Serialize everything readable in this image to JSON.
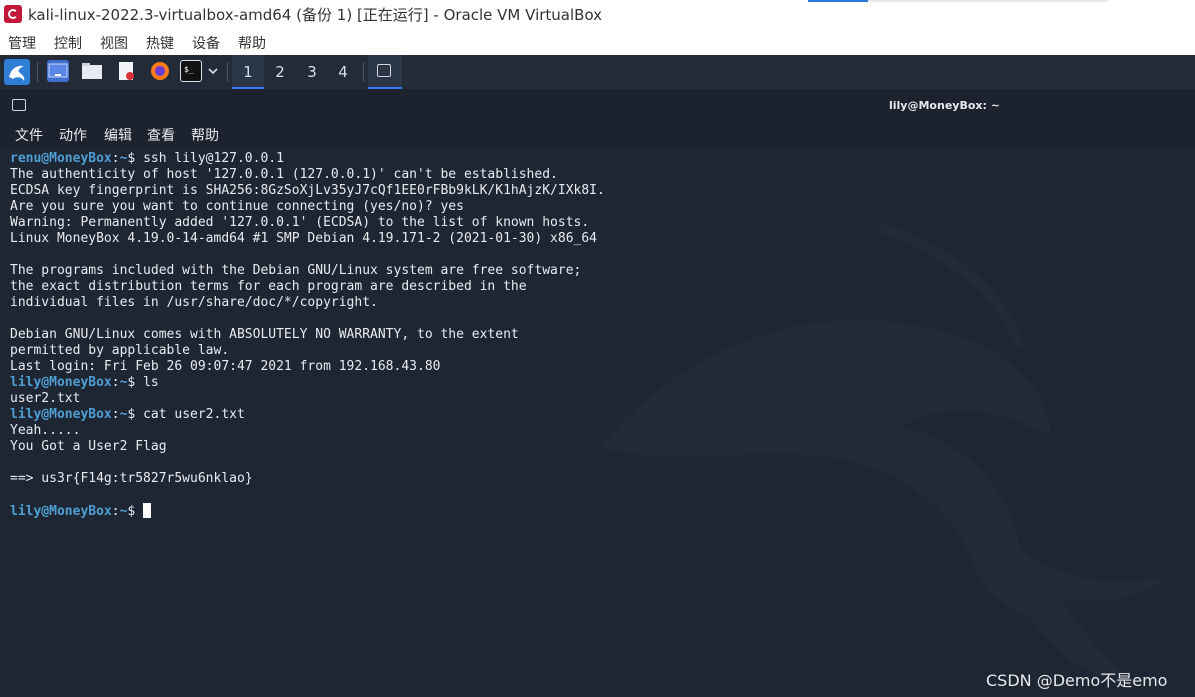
{
  "vbox": {
    "title": "kali-linux-2022.3-virtualbox-amd64 (备份 1) [正在运行] - Oracle VM VirtualBox",
    "menu": [
      "管理",
      "控制",
      "视图",
      "热键",
      "设备",
      "帮助"
    ]
  },
  "panel": {
    "icons": [
      "kali-menu-icon",
      "desktop-icon",
      "file-manager-icon",
      "text-editor-icon",
      "firefox-icon",
      "terminal-icon",
      "chevron-down-icon"
    ],
    "workspaces": [
      "1",
      "2",
      "3",
      "4"
    ],
    "active_workspace": "1"
  },
  "terminal": {
    "window_title": "lily@MoneyBox: ~",
    "menu": [
      "文件",
      "动作",
      "编辑",
      "查看",
      "帮助"
    ],
    "lines": [
      {
        "prompt": "renu@MoneyBox",
        "path": "~",
        "cmd": "ssh lily@127.0.0.1"
      },
      {
        "text": "The authenticity of host '127.0.0.1 (127.0.0.1)' can't be established."
      },
      {
        "text": "ECDSA key fingerprint is SHA256:8GzSoXjLv35yJ7cQf1EE0rFBb9kLK/K1hAjzK/IXk8I."
      },
      {
        "text": "Are you sure you want to continue connecting (yes/no)? yes"
      },
      {
        "text": "Warning: Permanently added '127.0.0.1' (ECDSA) to the list of known hosts."
      },
      {
        "text": "Linux MoneyBox 4.19.0-14-amd64 #1 SMP Debian 4.19.171-2 (2021-01-30) x86_64"
      },
      {
        "text": ""
      },
      {
        "text": "The programs included with the Debian GNU/Linux system are free software;"
      },
      {
        "text": "the exact distribution terms for each program are described in the"
      },
      {
        "text": "individual files in /usr/share/doc/*/copyright."
      },
      {
        "text": ""
      },
      {
        "text": "Debian GNU/Linux comes with ABSOLUTELY NO WARRANTY, to the extent"
      },
      {
        "text": "permitted by applicable law."
      },
      {
        "text": "Last login: Fri Feb 26 09:07:47 2021 from 192.168.43.80"
      },
      {
        "prompt": "lily@MoneyBox",
        "path": "~",
        "cmd": "ls"
      },
      {
        "text": "user2.txt"
      },
      {
        "prompt": "lily@MoneyBox",
        "path": "~",
        "cmd": "cat user2.txt"
      },
      {
        "text": "Yeah....."
      },
      {
        "text": "You Got a User2 Flag"
      },
      {
        "text": ""
      },
      {
        "text": "==> us3r{F14g:tr5827r5wu6nklao}"
      },
      {
        "text": ""
      },
      {
        "prompt": "lily@MoneyBox",
        "path": "~",
        "cmd": "",
        "cursor": true
      }
    ]
  },
  "watermark": "CSDN @Demo不是emo"
}
